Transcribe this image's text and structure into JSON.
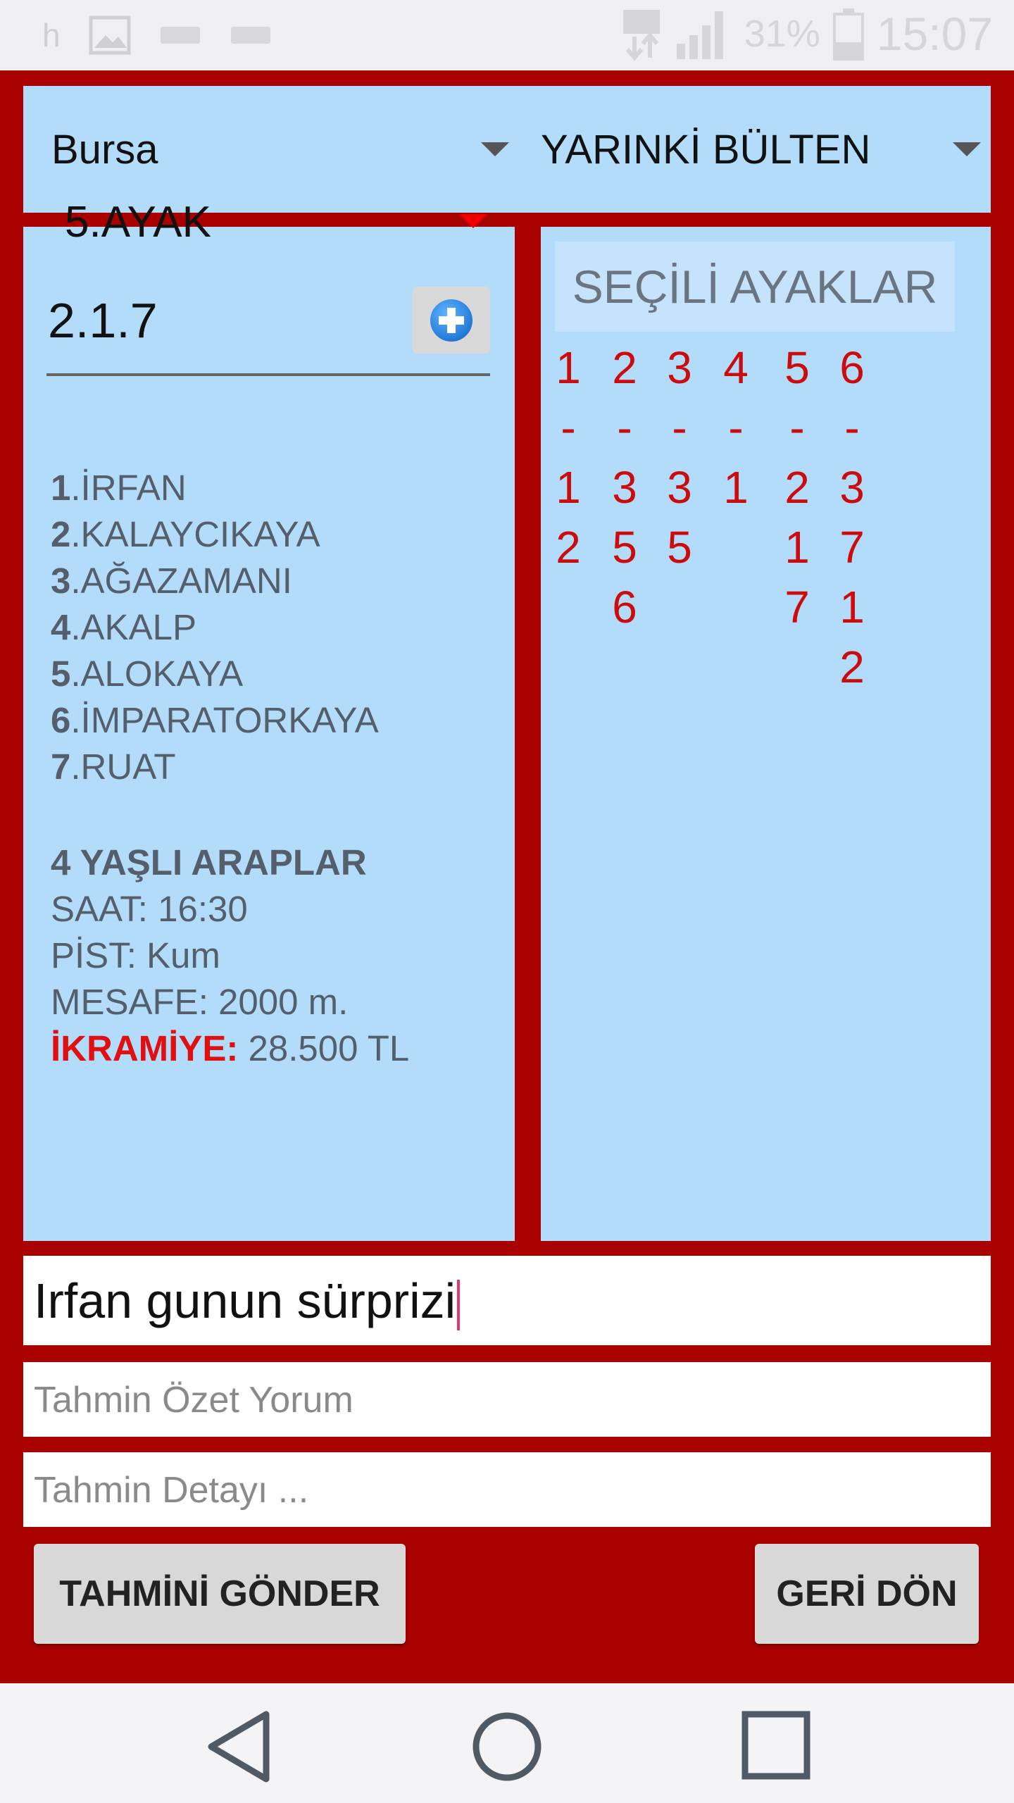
{
  "status_bar": {
    "left_letter": "h",
    "battery": "31%",
    "time": "15:07"
  },
  "top_row": {
    "city": "Bursa",
    "bulletin": "YARINKİ BÜLTEN"
  },
  "left_panel": {
    "leg_selector": "5.AYAK",
    "code_value": "2.1.7",
    "horses": [
      {
        "num": "1",
        "name": ".İRFAN"
      },
      {
        "num": "2",
        "name": ".KALAYCIKAYA"
      },
      {
        "num": "3",
        "name": ".AĞAZAMANI"
      },
      {
        "num": "4",
        "name": ".AKALP"
      },
      {
        "num": "5",
        "name": ".ALOKAYA"
      },
      {
        "num": "6",
        "name": ".İMPARATORKAYA"
      },
      {
        "num": "7",
        "name": ".RUAT"
      }
    ],
    "race": {
      "title": "4 YAŞLI ARAPLAR",
      "time": "SAAT: 16:30",
      "track": "PİST: Kum",
      "distance": "MESAFE: 2000 m.",
      "prize_label": "İKRAMİYE:",
      "prize_value": " 28.500 TL"
    }
  },
  "right_panel": {
    "header": "SEÇİLİ AYAKLAR",
    "legs": [
      {
        "leg": "1",
        "sep": "-",
        "picks": [
          "1",
          "2"
        ]
      },
      {
        "leg": "2",
        "sep": "-",
        "picks": [
          "3",
          "5",
          "6"
        ]
      },
      {
        "leg": "3",
        "sep": "-",
        "picks": [
          "3",
          "5"
        ]
      },
      {
        "leg": "4",
        "sep": "-",
        "picks": [
          "1"
        ]
      },
      {
        "leg": "5",
        "sep": "-",
        "picks": [
          "2",
          "1",
          "7"
        ]
      },
      {
        "leg": "6",
        "sep": "-",
        "picks": [
          "3",
          "7",
          "1",
          "2"
        ]
      }
    ]
  },
  "inputs": {
    "title_value": "Irfan gunun sürprizi",
    "summary_placeholder": "Tahmin Özet Yorum",
    "detail_placeholder": "Tahmin Detayı ..."
  },
  "buttons": {
    "send": "TAHMİNİ GÖNDER",
    "back": "GERİ DÖN"
  },
  "colors": {
    "frame": "#a90000",
    "panel": "#b3dcfb",
    "accent_red": "#cc0c0c"
  }
}
